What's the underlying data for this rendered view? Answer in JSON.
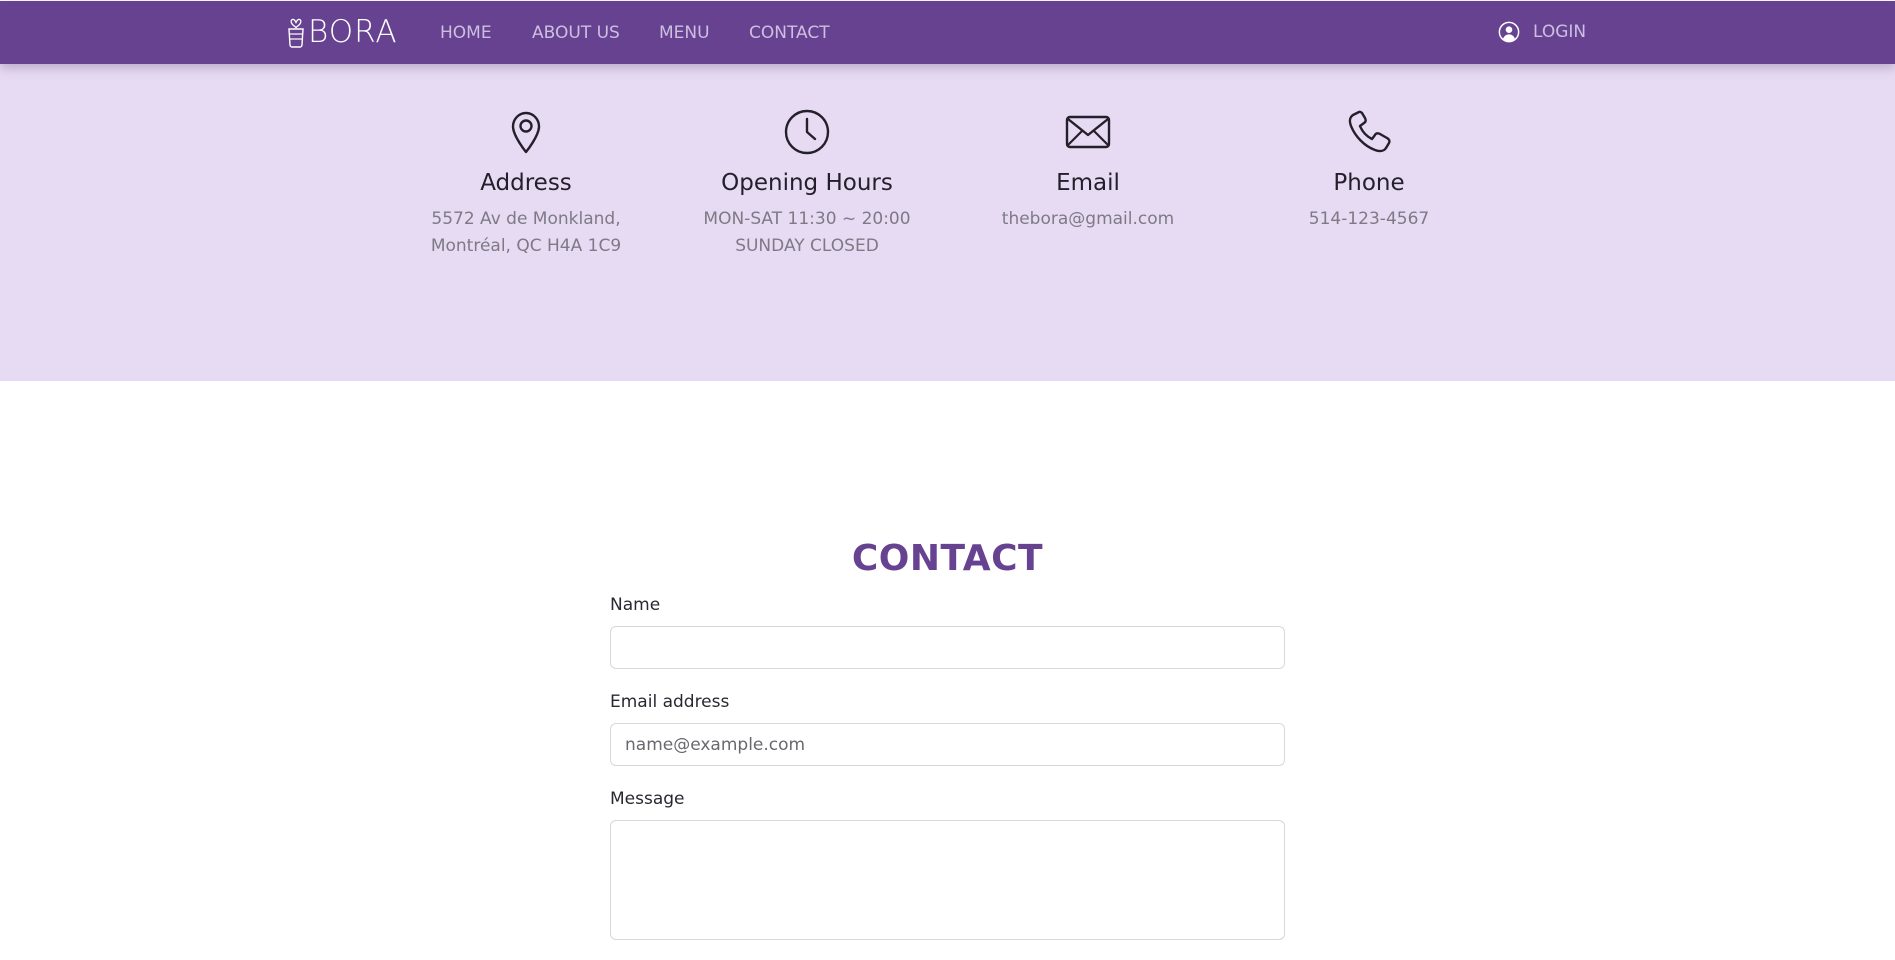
{
  "nav": {
    "brand": "BORA",
    "links": [
      {
        "label": "HOME"
      },
      {
        "label": "ABOUT US"
      },
      {
        "label": "MENU"
      },
      {
        "label": "CONTACT"
      }
    ],
    "login_label": "LOGIN",
    "login_icon": "user-circle-icon"
  },
  "info": {
    "address": {
      "icon": "map-pin-icon",
      "title": "Address",
      "line1": "5572 Av de Monkland,",
      "line2": "Montréal, QC H4A 1C9"
    },
    "hours": {
      "icon": "clock-icon",
      "title": "Opening Hours",
      "line1": "MON-SAT 11:30 ~ 20:00",
      "line2": "SUNDAY CLOSED"
    },
    "email": {
      "icon": "envelope-icon",
      "title": "Email",
      "line1": "thebora@gmail.com"
    },
    "phone": {
      "icon": "phone-icon",
      "title": "Phone",
      "line1": "514-123-4567"
    }
  },
  "contact": {
    "title": "CONTACT",
    "name_label": "Name",
    "name_value": "",
    "email_label": "Email address",
    "email_placeholder": "name@example.com",
    "message_label": "Message",
    "message_value": ""
  },
  "colors": {
    "navbar": "#674290",
    "info_band": "#e7dbf3",
    "accent": "#674290"
  }
}
